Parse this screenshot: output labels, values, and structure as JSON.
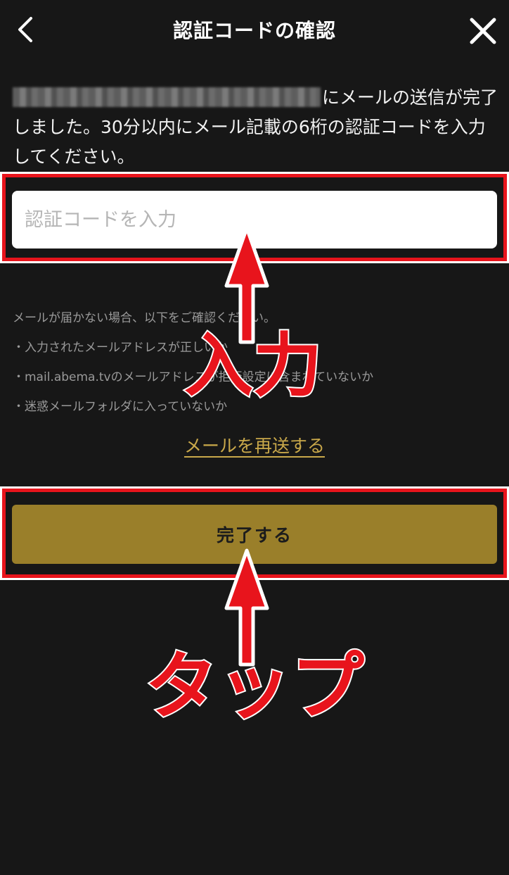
{
  "header": {
    "title": "認証コードの確認"
  },
  "message": {
    "text": "にメールの送信が完了しました。30分以内にメール記載の6桁の認証コードを入力してください。"
  },
  "code_input": {
    "placeholder": "認証コードを入力",
    "value": ""
  },
  "help": {
    "heading": "メールが届かない場合、以下をご確認ください。",
    "items": [
      "・入力されたメールアドレスが正しいか",
      "・mail.abema.tvのメールアドレスが拒否設定に含まれていないか",
      "・迷惑メールフォルダに入っていないか"
    ]
  },
  "resend_label": "メールを再送する",
  "complete_label": "完了する",
  "annotations": {
    "input_label": "入力",
    "tap_label": "タップ"
  },
  "colors": {
    "background": "#171717",
    "accent_gold": "#9a7f2a",
    "link_gold": "#c9a84a",
    "annotation_red": "#e8141c"
  },
  "icons": {
    "back": "chevron-left-icon",
    "close": "close-icon"
  }
}
